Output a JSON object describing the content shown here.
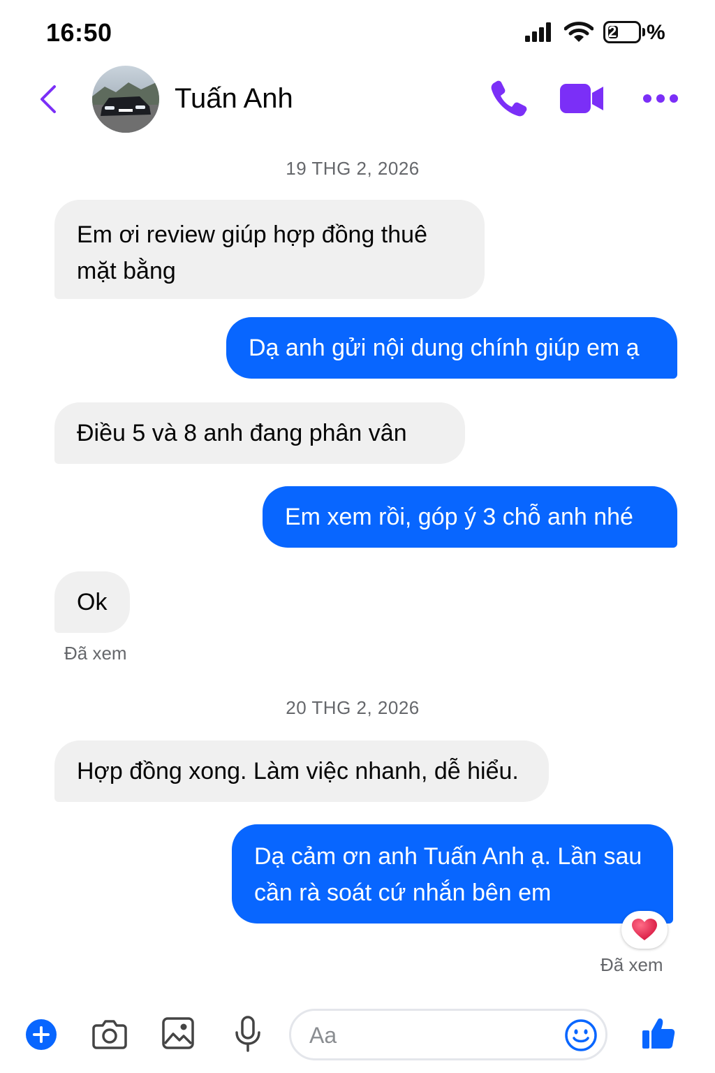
{
  "status_bar": {
    "time": "16:50",
    "battery_level": "2",
    "battery_percent_sign": "%",
    "battery_fraction": 0.02
  },
  "header": {
    "contact_name": "Tuấn Anh",
    "icons": [
      "back-chevron-icon",
      "phone-icon",
      "video-camera-icon",
      "more-dots-icon"
    ],
    "accent_color": "#7b2ff7"
  },
  "conversation": {
    "date_1": "19 THG 2, 2026",
    "messages_1": [
      {
        "from": "contact",
        "lines": [
          "Em ơi review giúp hợp đồng thuê",
          "mặt bằng"
        ]
      },
      {
        "from": "me",
        "text": "Dạ anh gửi nội dung chính giúp em ạ"
      },
      {
        "from": "contact",
        "text": "Điều 5 và 8 anh đang phân vân"
      },
      {
        "from": "me",
        "text": "Em xem rồi, góp ý 3 chỗ anh nhé"
      },
      {
        "from": "contact",
        "text": "Ok"
      }
    ],
    "seen_1": "Đã xem",
    "date_2": "20 THG 2, 2026",
    "messages_2": [
      {
        "from": "contact",
        "text": "Hợp đồng xong. Làm việc nhanh, dễ hiểu."
      },
      {
        "from": "me",
        "lines": [
          "Dạ cảm ơn anh Tuấn Anh ạ. Lần sau",
          "cần rà soát cứ nhắn bên em"
        ],
        "reaction": "heart"
      }
    ],
    "seen_2": "Đã xem",
    "colors": {
      "outgoing_bubble": "#0866ff",
      "incoming_bubble": "#f0f0f0",
      "reaction_heart": "#e0245e"
    }
  },
  "composer": {
    "placeholder": "Aa",
    "icons": [
      "plus-icon",
      "camera-icon",
      "image-icon",
      "microphone-icon",
      "emoji-icon",
      "thumbs-up-icon"
    ]
  }
}
